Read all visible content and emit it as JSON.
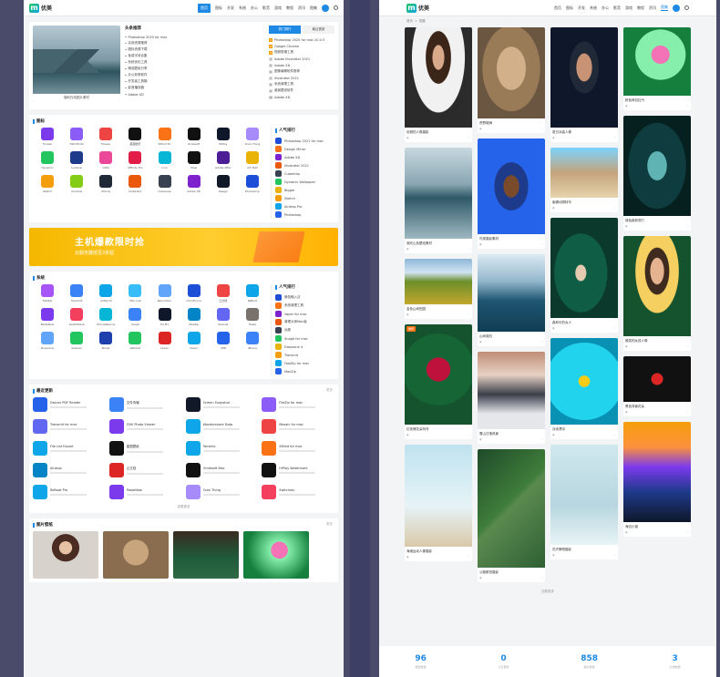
{
  "colors": {
    "brand": "#1e88e5",
    "page_bg": "#f3f4f6",
    "banner": "#f5b800"
  },
  "left": {
    "logo_text": "优美",
    "nav": [
      "首页",
      "图标",
      "开发",
      "系统",
      "办公",
      "影音",
      "游戏",
      "教程",
      "资讯",
      "图集"
    ],
    "hero": {
      "caption": "福利在线图片素材",
      "list_title": "头条推荐",
      "list": [
        "Photoshop 2020 for mac",
        "实用资源推荐",
        "图标资源下载",
        "免费字体合集",
        "系统优化工具",
        "精选壁纸分享",
        "办公效率软件",
        "开发者工具箱",
        "影音播放器",
        "Adobe XD"
      ],
      "tabs": [
        "热门排行",
        "最近更新"
      ],
      "ranks": [
        "Photoshop 2020 for mac 20.0.5",
        "Google Chrome",
        "视频剪辑工具",
        "Adobe Illustrator 2021",
        "Adobe XD",
        "图像编辑软件推荐",
        "Illustrator 2021",
        "系统清理工具",
        "桌面壁纸软件",
        "Adobe XD"
      ]
    },
    "icons_section": {
      "title": "图标",
      "more": "更多",
      "side_title": "人气排行",
      "apps": [
        {
          "name": "Screen",
          "color": "#7c3aed"
        },
        {
          "name": "OWI Photo",
          "color": "#8b5cf6"
        },
        {
          "name": "Mosaic",
          "color": "#ef4444"
        },
        {
          "name": "星图壁纸",
          "color": "#111111"
        },
        {
          "name": "XMind for",
          "color": "#f97316"
        },
        {
          "name": "Ondesoft",
          "color": "#111111"
        },
        {
          "name": "HiPlay",
          "color": "#0f172a"
        },
        {
          "name": "Scan Thing",
          "color": "#a78bfa"
        },
        {
          "name": "Dynamic",
          "color": "#22c55e"
        },
        {
          "name": "Luminar",
          "color": "#1e3a8a"
        },
        {
          "name": "Gifox",
          "color": "#ec4899"
        },
        {
          "name": "Affinity Pro",
          "color": "#e11d48"
        },
        {
          "name": "Icon",
          "color": "#06b6d4"
        },
        {
          "name": "Pixel",
          "color": "#111111"
        },
        {
          "name": "Adobe After",
          "color": "#4c1d95"
        },
        {
          "name": "Art Text",
          "color": "#eab308"
        },
        {
          "name": "Sketch",
          "color": "#f59e0b"
        },
        {
          "name": "Airadine",
          "color": "#84cc16"
        },
        {
          "name": "iPhone",
          "color": "#1f2937"
        },
        {
          "name": "Illustrator",
          "color": "#ea580c"
        },
        {
          "name": "Cubemap",
          "color": "#374151"
        },
        {
          "name": "Adobe XD",
          "color": "#7e22ce"
        },
        {
          "name": "Design",
          "color": "#111827"
        },
        {
          "name": "Photoshop",
          "color": "#1d4ed8"
        }
      ],
      "side": [
        "Photoshop 2021 for mac",
        "Design Mirror",
        "Adobe XD",
        "Illustrator 2021",
        "Cubemap",
        "Dynamic Wallpaper",
        "Bigger",
        "Sketch",
        "Airdrop Pro",
        "Photoshop"
      ]
    },
    "banner": {
      "title": "主机爆款限时抢",
      "sub": "云服务器低至2折起"
    },
    "system_section": {
      "title": "系统",
      "more": "更多",
      "side_title": "人气排行",
      "apps": [
        {
          "name": "FastZip",
          "color": "#a855f7"
        },
        {
          "name": "Transmit",
          "color": "#3b82f6"
        },
        {
          "name": "AirParrot",
          "color": "#0ea5e9"
        },
        {
          "name": "Mac Lab",
          "color": "#38bdf8"
        },
        {
          "name": "Resolution",
          "color": "#60a5fa"
        },
        {
          "name": "OmniFocus",
          "color": "#1d4ed8"
        },
        {
          "name": "云文档",
          "color": "#ef4444"
        },
        {
          "name": "ReBoot",
          "color": "#0ea5e9"
        },
        {
          "name": "PasteNow",
          "color": "#7c3aed"
        },
        {
          "name": "SwitchResX",
          "color": "#f43f5e"
        },
        {
          "name": "PhoneRescue",
          "color": "#06b6d4"
        },
        {
          "name": "Snapt",
          "color": "#3b82f6"
        },
        {
          "name": "TG Pro",
          "color": "#0f172a"
        },
        {
          "name": "MaxZip",
          "color": "#0284c7"
        },
        {
          "name": "Downie",
          "color": "#6366f1"
        },
        {
          "name": "Hazel",
          "color": "#78716c"
        },
        {
          "name": "Dropzone",
          "color": "#60a5fa"
        },
        {
          "name": "Cleaner",
          "color": "#22c55e"
        },
        {
          "name": "Boost",
          "color": "#1e40af"
        },
        {
          "name": "WeChat",
          "color": "#22c55e"
        },
        {
          "name": "Clean",
          "color": "#dc2626"
        },
        {
          "name": "Vision",
          "color": "#0ea5e9"
        },
        {
          "name": "VPN",
          "color": "#2563eb"
        },
        {
          "name": "iPhone",
          "color": "#3b82f6"
        }
      ],
      "side": [
        "微信输入法",
        "系统清理工具",
        "Vaper for mac",
        "清理大师Mac版",
        "远程",
        "Snagit for mac",
        "Dropzone 4",
        "Transmit",
        "FastZip for mac",
        "MaxZip"
      ]
    },
    "recent_section": {
      "title": "最近更新",
      "more": "更多",
      "load_more": "加载更多",
      "items": [
        {
          "name": "Daicon PDF Reader",
          "color": "#2563eb"
        },
        {
          "name": "文件传输",
          "color": "#3b82f6"
        },
        {
          "name": "Screen Snapshot",
          "color": "#111827"
        },
        {
          "name": "FileZip for mac",
          "color": "#8b5cf6"
        },
        {
          "name": "Transmit for mac",
          "color": "#6366f1"
        },
        {
          "name": "CNV Photo Viewer",
          "color": "#7c3aed"
        },
        {
          "name": "Wondershare Data",
          "color": "#0ea5e9"
        },
        {
          "name": "Mosaic for mac",
          "color": "#ef4444"
        },
        {
          "name": "File List Export",
          "color": "#0ea5e9"
        },
        {
          "name": "星图壁纸",
          "color": "#111111"
        },
        {
          "name": "Recents",
          "color": "#0ea5e9"
        },
        {
          "name": "XMind for mac",
          "color": "#f97316"
        },
        {
          "name": "Airdrop",
          "color": "#0284c7"
        },
        {
          "name": "云文档",
          "color": "#dc2626"
        },
        {
          "name": "Ondesoft Mac",
          "color": "#111111"
        },
        {
          "name": "HiPlay Watermark",
          "color": "#111111"
        },
        {
          "name": "ReBoot Pro",
          "color": "#0ea5e9"
        },
        {
          "name": "PasteNow",
          "color": "#7c3aed"
        },
        {
          "name": "Scan Thing",
          "color": "#a78bfa"
        },
        {
          "name": "Switchres",
          "color": "#f43f5e"
        }
      ]
    },
    "photos_section": {
      "title": "图片壁纸",
      "more": "更多"
    }
  },
  "right": {
    "logo_text": "优美",
    "nav": [
      "首页",
      "图标",
      "开发",
      "系统",
      "办公",
      "影音",
      "游戏",
      "教程",
      "资讯",
      "图集"
    ],
    "breadcrumb": [
      "首页",
      "图集"
    ],
    "columns": [
      [
        {
          "title": "优雅的人像摄影",
          "tone": "portrait-woman",
          "h": 110
        },
        {
          "title": "湖光山色壁纸素材",
          "tone": "lake",
          "h": 100
        },
        {
          "title": "金色山间田园",
          "tone": "field",
          "h": 50
        },
        {
          "title": "红玫瑰花朵特写",
          "tone": "rose",
          "h": 110,
          "tag": "推荐"
        },
        {
          "title": "海滩运动人像摄影",
          "tone": "beach",
          "h": 112
        }
      ],
      [
        {
          "title": "荒野雄狮",
          "tone": "lion",
          "h": 100
        },
        {
          "title": "鸟类摄影素材",
          "tone": "bird",
          "h": 105
        },
        {
          "title": "山间湖泊",
          "tone": "lake2",
          "h": 85
        },
        {
          "title": "雪山日落风景",
          "tone": "mountain",
          "h": 85
        },
        {
          "title": "公路俯拍摄影",
          "tone": "road",
          "h": 130
        }
      ],
      [
        {
          "title": "夏日泳装人像",
          "tone": "swimwear",
          "h": 110
        },
        {
          "title": "蜥蜴动物特写",
          "tone": "lizard",
          "h": 55
        },
        {
          "title": "森林中的女人",
          "tone": "forest",
          "h": 110
        },
        {
          "title": "泳池漂浮",
          "tone": "pool",
          "h": 95
        },
        {
          "title": "花卉静物摄影",
          "tone": "flowers",
          "h": 110
        }
      ],
      [
        {
          "title": "粉色荷包牡丹",
          "tone": "pink",
          "h": 75
        },
        {
          "title": "绿色森林洞穴",
          "tone": "cave",
          "h": 110
        },
        {
          "title": "微笑的女孩人像",
          "tone": "smile",
          "h": 110
        },
        {
          "title": "黑色背景花朵",
          "tone": "darkflower",
          "h": 50
        },
        {
          "title": "海边小镇",
          "tone": "town",
          "h": 110
        }
      ]
    ],
    "load_more": "加载更多",
    "stats": [
      {
        "num": "96",
        "label": "图集数量"
      },
      {
        "num": "0",
        "label": "今日更新"
      },
      {
        "num": "858",
        "label": "图片数量"
      },
      {
        "num": "3",
        "label": "分类数量"
      }
    ]
  }
}
